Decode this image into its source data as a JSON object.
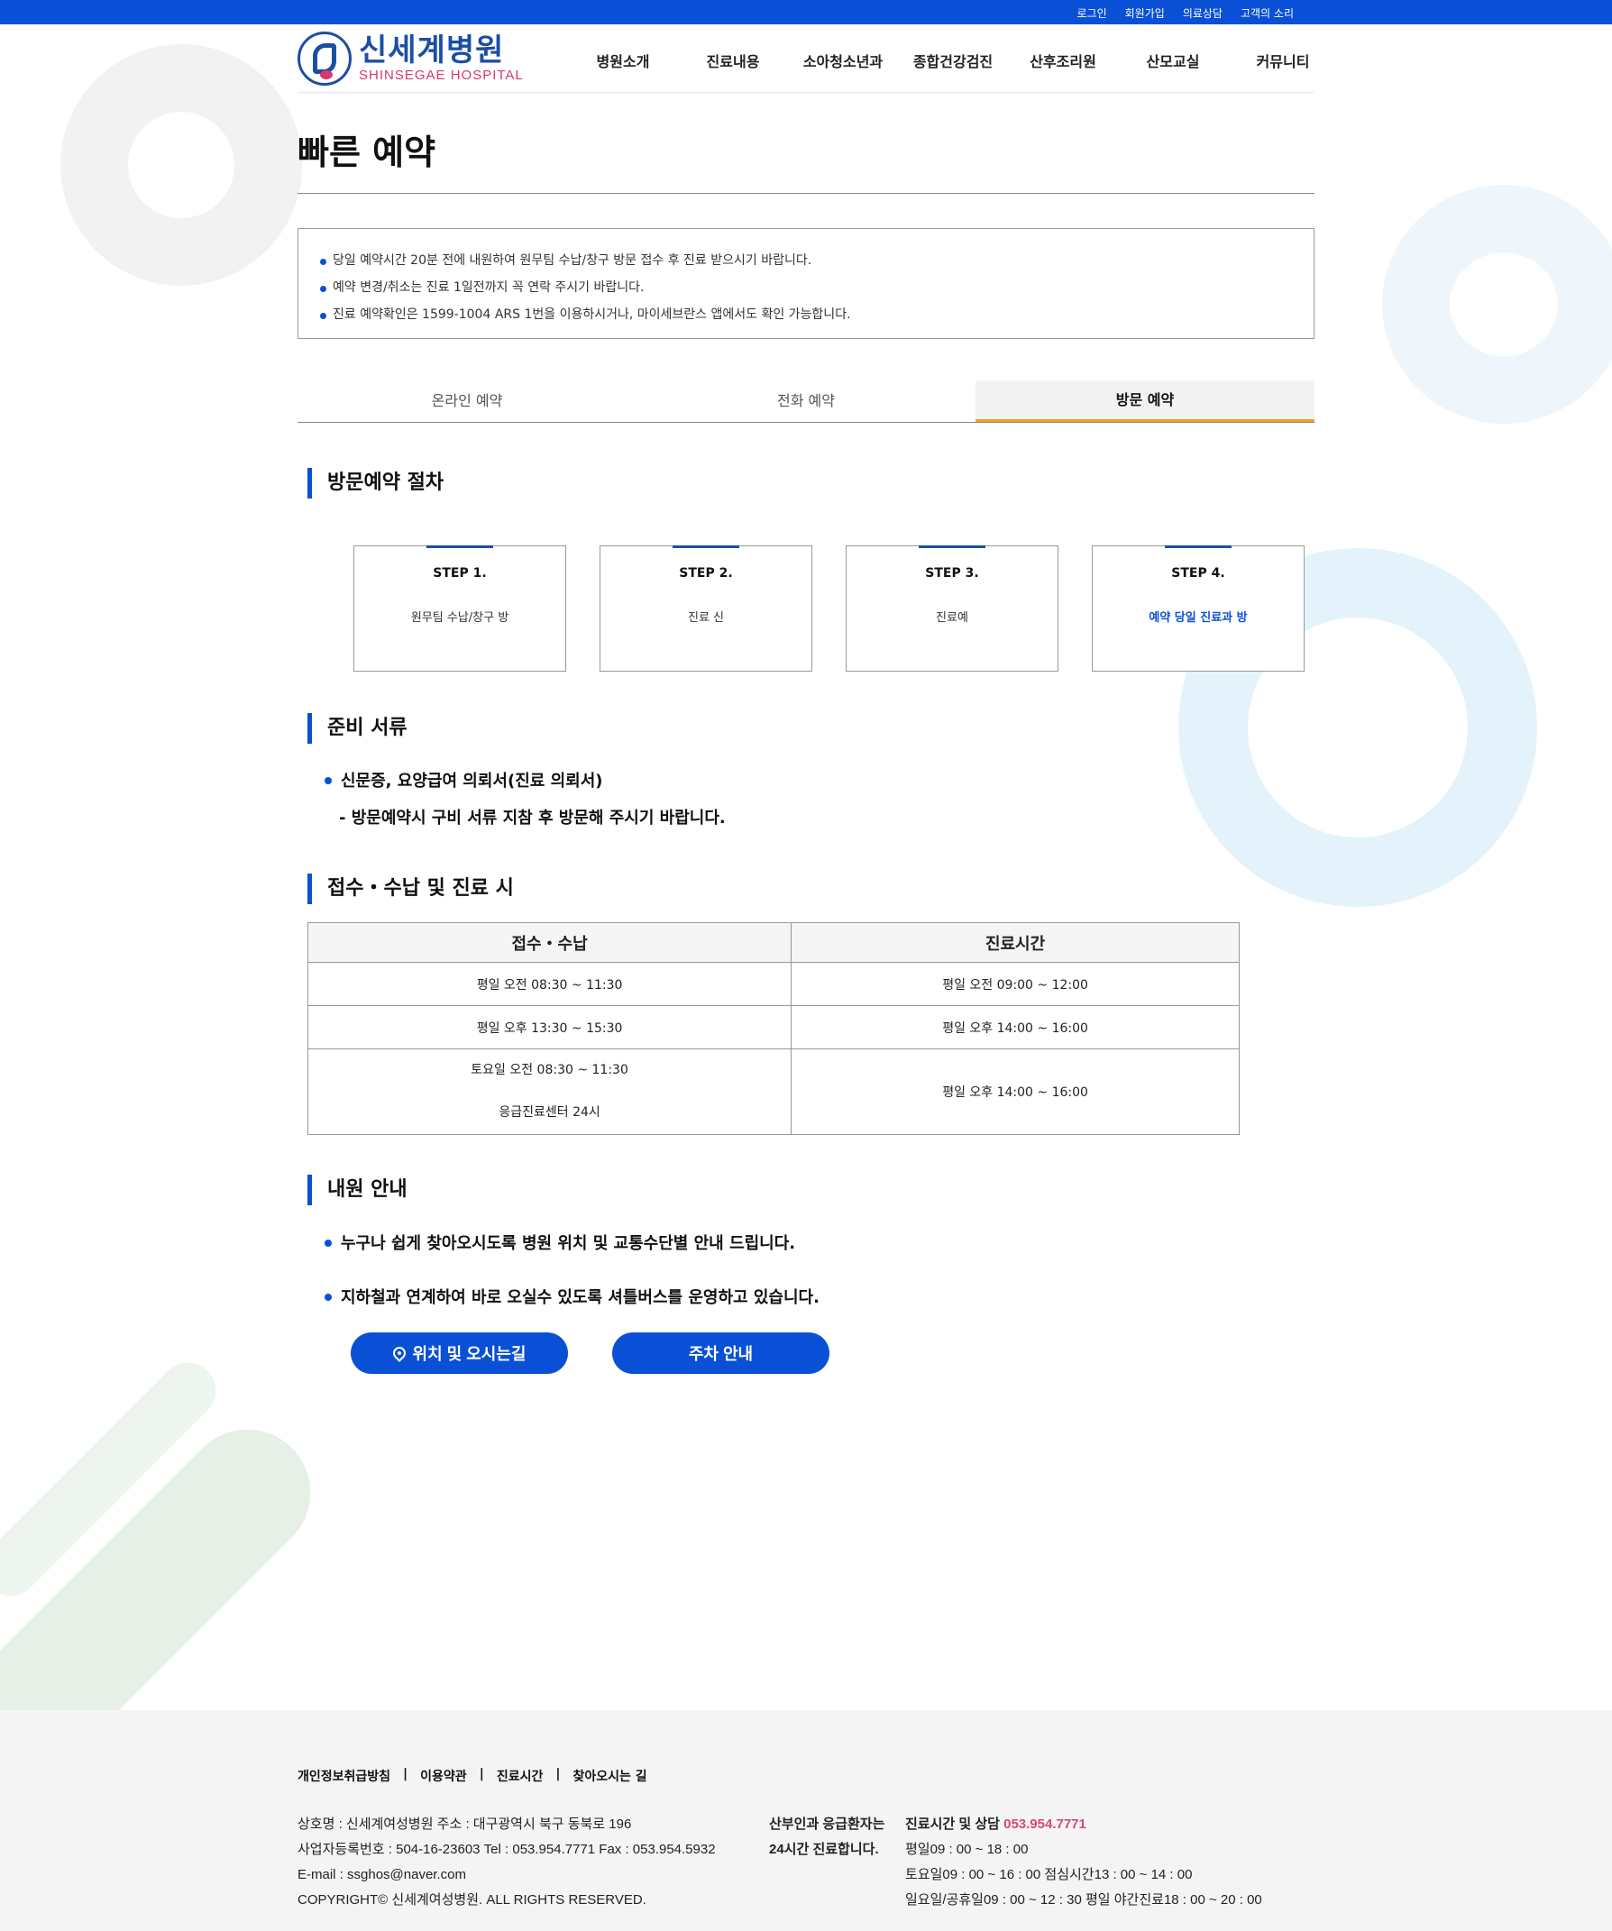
{
  "topbar": {
    "links": [
      "로그인",
      "회원가입",
      "의료상담",
      "고객의 소리"
    ]
  },
  "header": {
    "logo_ko": "신세계병원",
    "logo_en": "SHINSEGAE HOSPITAL",
    "nav": [
      "병원소개",
      "진료내용",
      "소아청소년과",
      "종합건강검진",
      "산후조리원",
      "산모교실",
      "커뮤니티"
    ]
  },
  "page": {
    "title": "빠른 예약"
  },
  "notice": [
    "당일 예약시간 20분 전에 내원하여 원무팀 수납/창구 방문 접수 후 진료 받으시기 바랍니다.",
    "예약 변경/취소는 진료 1일전까지 꼭 연락 주시기 바랍니다.",
    "진료 예약확인은 1599-1004 ARS 1번을 이용하시거나, 마이세브란스 앱에서도 확인 가능합니다."
  ],
  "tabs": [
    {
      "label": "온라인 예약",
      "active": false
    },
    {
      "label": "전화 예약",
      "active": false
    },
    {
      "label": "방문 예약",
      "active": true
    }
  ],
  "procedure": {
    "title": "방문예약 절차",
    "steps": [
      {
        "num": "STEP 1.",
        "desc": "원무팀 수납/창구 방"
      },
      {
        "num": "STEP 2.",
        "desc": "진료 신"
      },
      {
        "num": "STEP 3.",
        "desc": "진료예"
      },
      {
        "num": "STEP 4.",
        "desc": "예약 당일 진료과 방"
      }
    ]
  },
  "documents": {
    "title": "준비 서류",
    "item": "신문증, 요양급여 의뢰서(진료 의뢰서)",
    "note": "- 방문예약시 구비 서류 지참 후 방문해 주시기 바랍니다."
  },
  "hours": {
    "title": "접수・수납 및 진료 시",
    "headers": [
      "접수・수납",
      "진료시간"
    ],
    "rows": [
      {
        "reception": "평일 오전 08:30 ~ 11:30",
        "clinic": "평일 오전 09:00 ~ 12:00"
      },
      {
        "reception": "평일 오후 13:30 ~ 15:30",
        "clinic": "평일 오후 14:00 ~ 16:00"
      },
      {
        "reception": "토요일 오전 08:30 ~ 11:30",
        "reception2": "응급진료센터 24시",
        "clinic": "평일 오후 14:00 ~ 16:00"
      }
    ]
  },
  "visit": {
    "title": "내원 안내",
    "items": [
      "누구나 쉽게 찾아오시도록 병원 위치 및 교통수단별 안내 드립니다.",
      "지하철과 연계하여 바로 오실수 있도록 셔틀버스를 운영하고 있습니다."
    ],
    "btn_location": "위치 및 오시는길",
    "btn_parking": "주차 안내"
  },
  "footer": {
    "links": [
      "개인정보취급방침",
      "이용약관",
      "진료시간",
      "찾아오시는 길"
    ],
    "info": [
      "상호명 : 신세계여성병원 주소 : 대구광역시 북구 동북로 196",
      "사업자등록번호 : 504-16-23603 Tel : 053.954.7771 Fax : 053.954.5932",
      "E-mail : ssghos@naver.com",
      "COPYRIGHT© 신세계여성병원. ALL RIGHTS RESERVED."
    ],
    "emergency": [
      "산부인과 응급환자는",
      "24시간 진료합니다."
    ],
    "hours_label": "진료시간 및 상담",
    "phone": "053.954.7771",
    "hours_lines": [
      "평일09 : 00 ~ 18 : 00",
      "토요일09 : 00 ~ 16 : 00 점심시간13 : 00 ~ 14 : 00",
      "일요일/공휴일09 : 00 ~ 12 : 30 평일 야간진료18 : 00 ~ 20 : 00"
    ]
  },
  "colors": {
    "primary": "#0a50d6",
    "logo_blue": "#1c4fa3",
    "logo_pink": "#d63a6a",
    "tab_underline": "#f0a21c",
    "phone": "#d24a7e"
  }
}
